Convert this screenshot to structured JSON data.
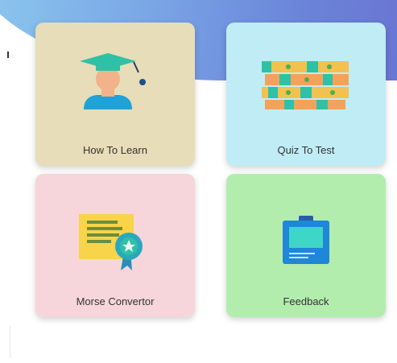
{
  "cards": [
    {
      "label": "How To Learn",
      "icon": "graduate-icon",
      "bg": "#e7ddb8"
    },
    {
      "label": "Quiz To Test",
      "icon": "blocks-icon",
      "bg": "#c0ecf6"
    },
    {
      "label": "Morse Convertor",
      "icon": "certificate-icon",
      "bg": "#f6d6da"
    },
    {
      "label": "Feedback",
      "icon": "clipboard-icon",
      "bg": "#b2edad"
    }
  ],
  "colors": {
    "header_gradient_start": "#8fd0f0",
    "header_gradient_end": "#6a6ed0",
    "text": "#333333"
  }
}
